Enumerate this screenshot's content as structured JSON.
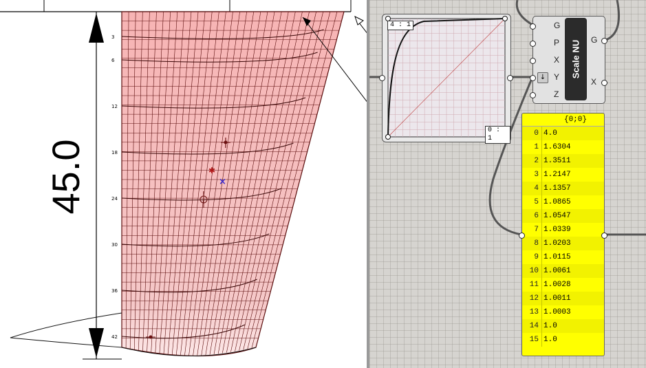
{
  "viewport": {
    "dimension_label": "45.0",
    "station_labels": [
      "3",
      "6",
      "12",
      "18",
      "24",
      "30",
      "36",
      "42"
    ]
  },
  "graph_mapper": {
    "top_label": "4 : 1",
    "bottom_label": "0 : 1"
  },
  "scale_nu": {
    "title": "Scale NU",
    "inputs": [
      "G",
      "P",
      "X",
      "Y",
      "Z"
    ],
    "outputs": [
      "G",
      "X"
    ]
  },
  "panel": {
    "header": "{0;0}",
    "rows": [
      {
        "index": "0",
        "value": "4.0"
      },
      {
        "index": "1",
        "value": "1.6304"
      },
      {
        "index": "2",
        "value": "1.3511"
      },
      {
        "index": "3",
        "value": "1.2147"
      },
      {
        "index": "4",
        "value": "1.1357"
      },
      {
        "index": "5",
        "value": "1.0865"
      },
      {
        "index": "6",
        "value": "1.0547"
      },
      {
        "index": "7",
        "value": "1.0339"
      },
      {
        "index": "8",
        "value": "1.0203"
      },
      {
        "index": "9",
        "value": "1.0115"
      },
      {
        "index": "10",
        "value": "1.0061"
      },
      {
        "index": "11",
        "value": "1.0028"
      },
      {
        "index": "12",
        "value": "1.0011"
      },
      {
        "index": "13",
        "value": "1.0003"
      },
      {
        "index": "14",
        "value": "1.0"
      },
      {
        "index": "15",
        "value": "1.0"
      }
    ]
  },
  "colors": {
    "surface_fill": "#f7b8b8",
    "surface_line": "#6a1010",
    "panel_bg": "#ffff00",
    "canvas_bg": "#d6d4d0",
    "marker_red": "#b01818",
    "marker_blue": "#3a2ad0"
  }
}
